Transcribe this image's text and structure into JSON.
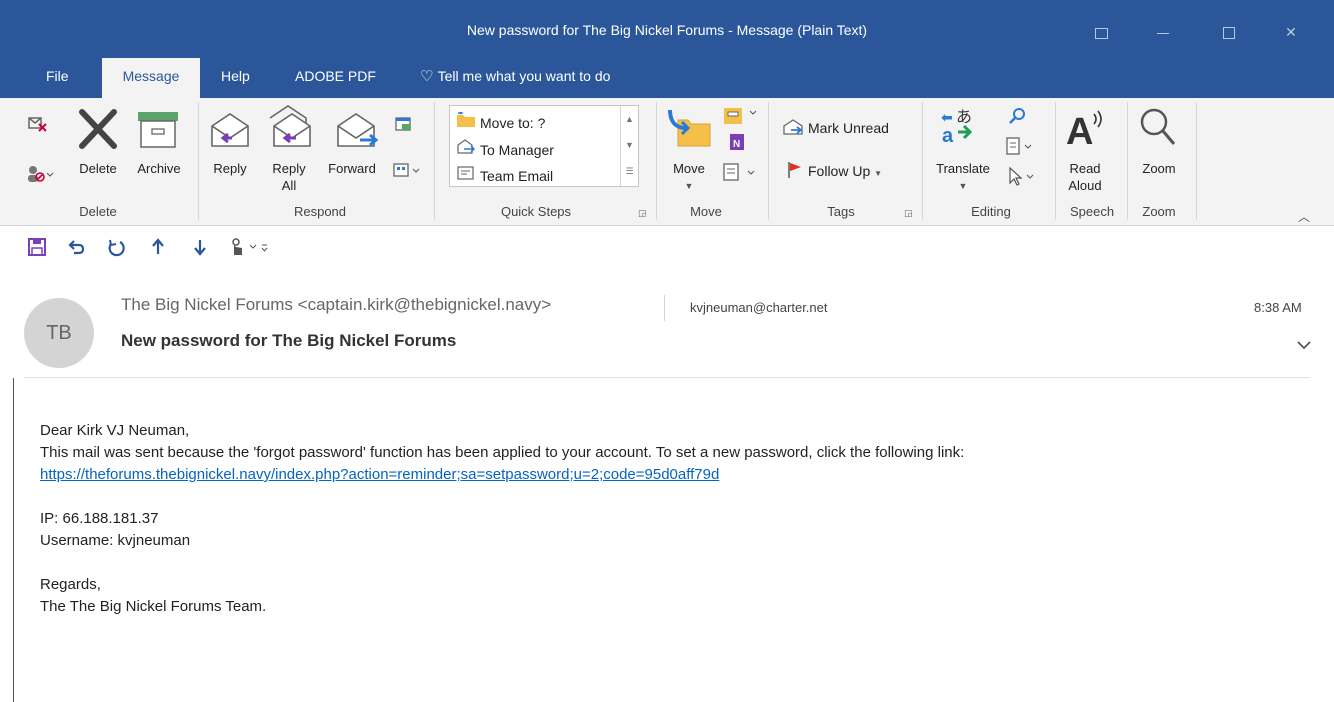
{
  "window": {
    "title": "New password for The Big Nickel Forums  -  Message (Plain Text)",
    "accent": "#2b579a"
  },
  "tabs": [
    {
      "label": "File"
    },
    {
      "label": "Message",
      "active": true
    },
    {
      "label": "Help"
    },
    {
      "label": "ADOBE PDF"
    },
    {
      "label": "Tell me what you want to do"
    }
  ],
  "ribbon": {
    "delete_group": {
      "label": "Delete",
      "delete": "Delete",
      "archive": "Archive"
    },
    "respond_group": {
      "label": "Respond",
      "reply": "Reply",
      "reply_all_1": "Reply",
      "reply_all_2": "All",
      "forward": "Forward"
    },
    "quick_steps": {
      "label": "Quick Steps",
      "items": [
        "Move to: ?",
        "To Manager",
        "Team Email"
      ]
    },
    "move_group": {
      "label": "Move",
      "move": "Move"
    },
    "tags_group": {
      "label": "Tags",
      "mark_unread": "Mark Unread",
      "follow_up": "Follow Up"
    },
    "editing_group": {
      "label": "Editing",
      "translate": "Translate"
    },
    "speech_group": {
      "label": "Speech",
      "read_1": "Read",
      "read_2": "Aloud"
    },
    "zoom_group": {
      "label": "Zoom",
      "zoom": "Zoom"
    }
  },
  "message": {
    "avatar_initials": "TB",
    "sender": "The Big Nickel Forums <captain.kirk@thebignickel.navy>",
    "to": "kvjneuman@charter.net",
    "time": "8:38 AM",
    "subject": "New password for The Big Nickel Forums",
    "body": {
      "greeting": "Dear Kirk  VJ Neuman,",
      "line1": "This mail was sent because the 'forgot password' function has been applied to your account. To set a new password, click the following link:",
      "link": "https://theforums.thebignickel.navy/index.php?action=reminder;sa=setpassword;u=2;code=95d0aff79d",
      "ip": "IP: 66.188.181.37",
      "username": "Username: kvjneuman",
      "regards": "Regards,",
      "signature": "The The Big Nickel Forums Team."
    }
  }
}
